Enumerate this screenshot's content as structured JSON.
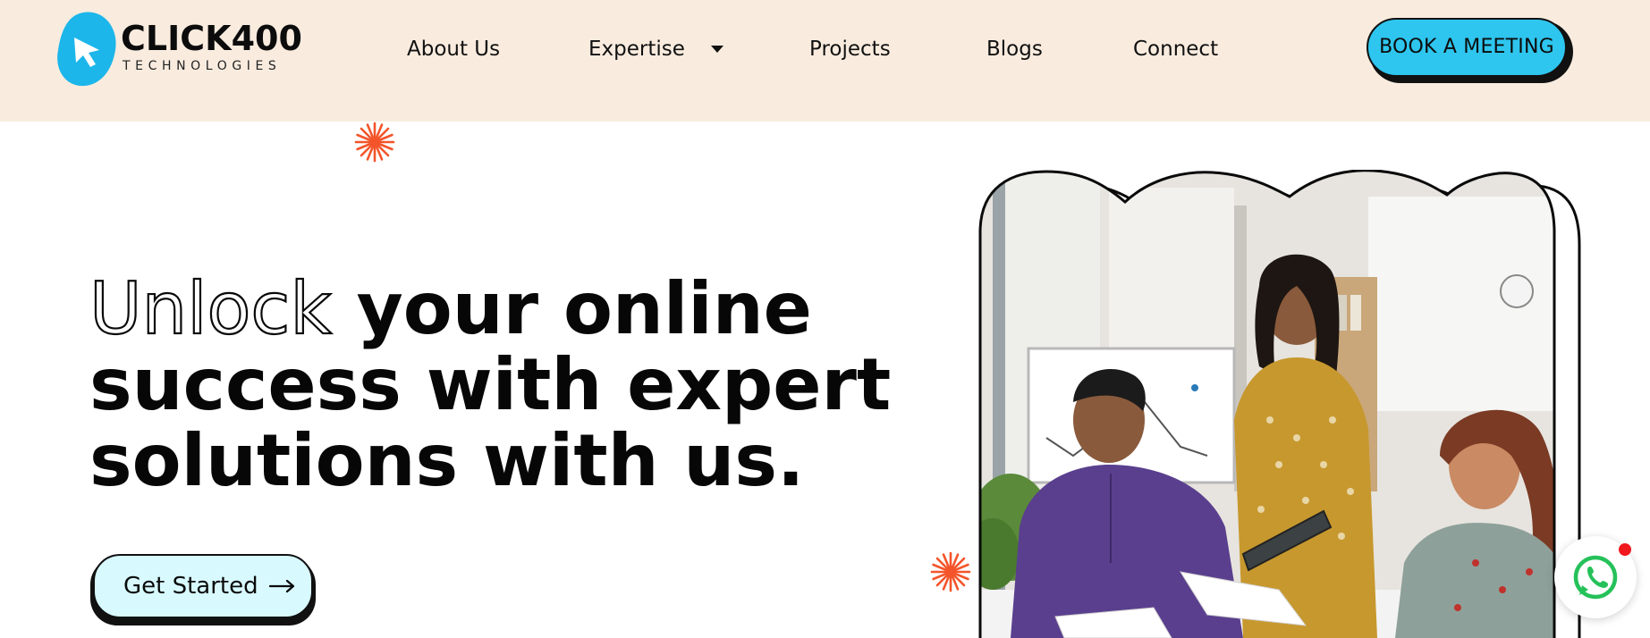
{
  "header": {
    "logo": {
      "name": "CLICK400",
      "sub": "TECHNOLOGIES",
      "icon": "cursor-blob-icon"
    },
    "nav": [
      {
        "label": "About Us"
      },
      {
        "label": "Expertise",
        "has_dropdown": true,
        "icon": "caret-down-icon"
      },
      {
        "label": "Projects"
      },
      {
        "label": "Blogs"
      },
      {
        "label": "Connect"
      }
    ],
    "cta_label": "BOOK A MEETING"
  },
  "hero": {
    "headline_outline_word": "Unlock",
    "headline_rest_line1": " your online",
    "headline_line2": "success with expert",
    "headline_line3": "solutions with us.",
    "cta_label": "Get Started",
    "cta_icon": "arrow-right-icon"
  },
  "colors": {
    "header_bg": "#f9ecdf",
    "accent_cyan": "#2ec6ef",
    "cta_bg": "#d8faff",
    "burst_orange": "#f4542a",
    "whatsapp_green": "#25c15a",
    "notification_red": "#f0181c"
  },
  "widgets": {
    "whatsapp_icon": "whatsapp-icon",
    "decor_icon": "sparkle-burst-icon"
  }
}
